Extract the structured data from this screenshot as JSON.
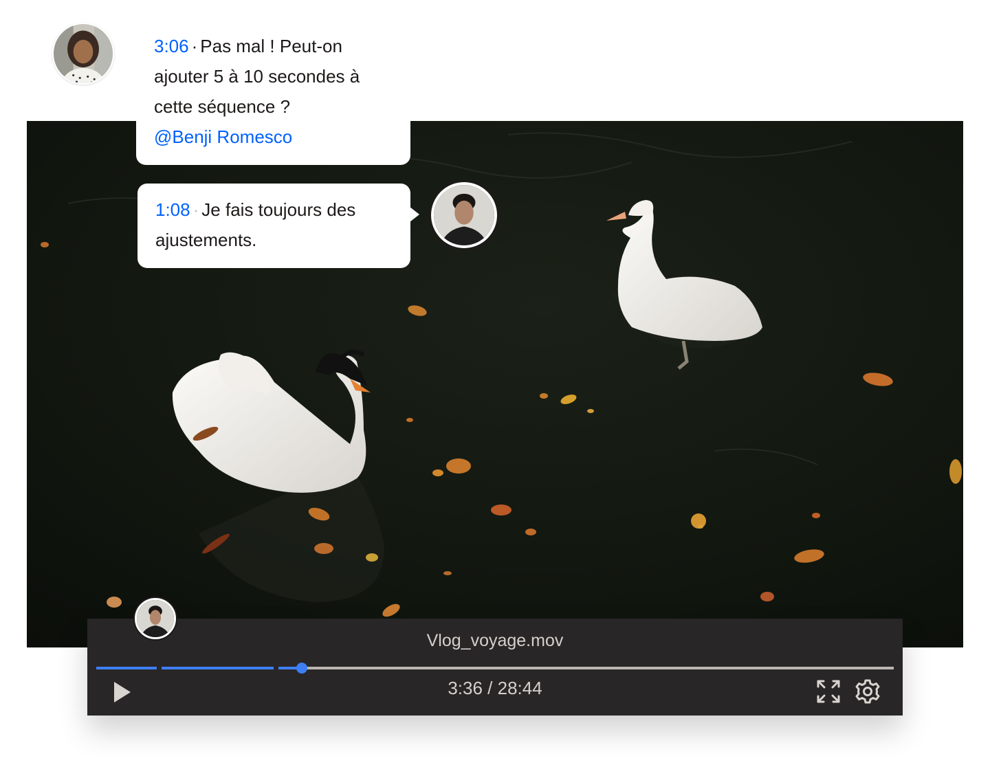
{
  "comments": [
    {
      "timestamp": "3:06",
      "separator": "·",
      "text": "Pas mal ! Peut-on ajouter 5 à 10 secondes à cette séquence ?",
      "mention": "@Benji Romesco"
    },
    {
      "timestamp": "1:08",
      "separator": "·",
      "text": "Je fais toujours des ajustements."
    }
  ],
  "player": {
    "file_name": "Vlog_voyage.mov",
    "time_display": "3:36 / 28:44",
    "progress_fraction": 0.128,
    "buffered_segments_fraction": [
      [
        0,
        0.075
      ],
      [
        0.081,
        0.222
      ],
      [
        0.228,
        0.258
      ]
    ],
    "controls": {
      "play_icon": "play-icon",
      "fullscreen_icon": "fullscreen-icon",
      "settings_icon": "gear-icon"
    }
  },
  "colors": {
    "accent": "#0061fe",
    "progress": "#3d7ef5",
    "player_bg": "#282626",
    "text": "#1e1919"
  }
}
